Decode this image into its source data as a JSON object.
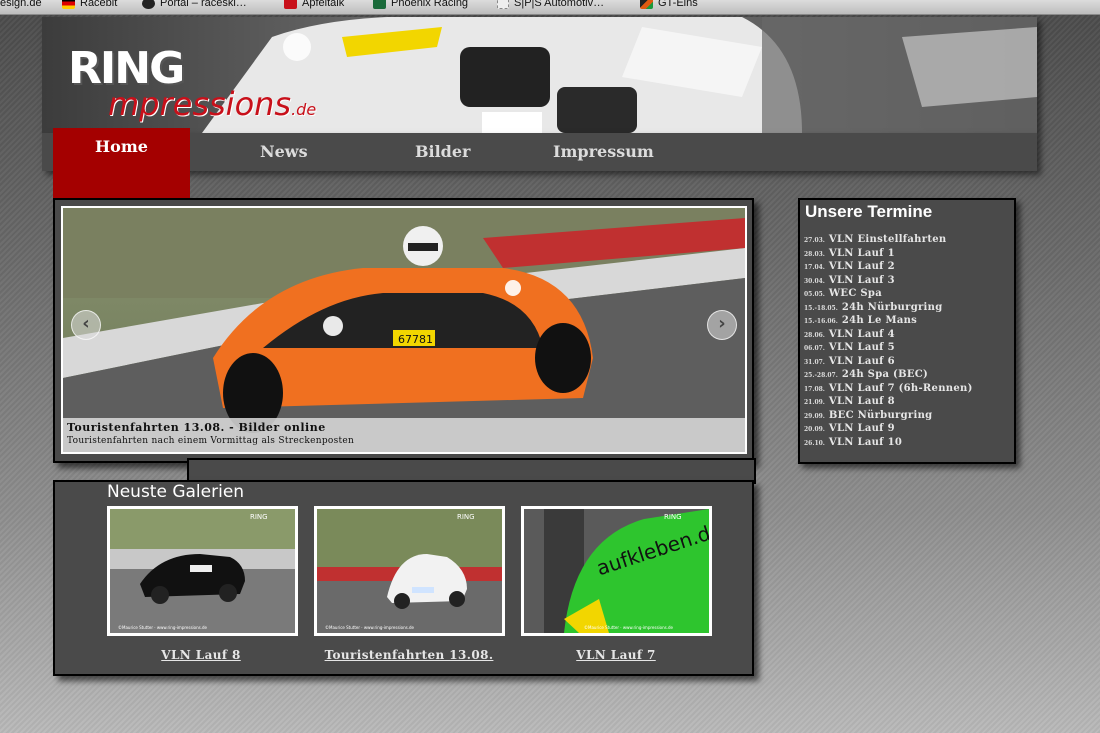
{
  "bookmarks": [
    {
      "label": "esign.de",
      "icon": "none",
      "color": "#000000"
    },
    {
      "label": "Racebit",
      "icon": "german-flag-icon",
      "color": "#cc0000"
    },
    {
      "label": "Portal – raceski…",
      "icon": "gear-icon",
      "color": "#222222"
    },
    {
      "label": "Apfeltalk",
      "icon": "apple-icon",
      "color": "#c8101a"
    },
    {
      "label": "Phoenix Racing",
      "icon": "p-icon",
      "color": "#1a6a3a"
    },
    {
      "label": "S|P|S Automotiv…",
      "icon": "page-icon",
      "color": "#9a9a9a"
    },
    {
      "label": "GT-Eins",
      "icon": "flame-icon",
      "color": "#d24a10"
    }
  ],
  "header": {
    "logo_main": "RING",
    "logo_sub": "mpressions",
    "logo_tld": ".de"
  },
  "nav": {
    "home": "Home",
    "news": "News",
    "bilder": "Bilder",
    "impressum": "Impressum"
  },
  "slider": {
    "caption_title": "Touristenfahrten 13.08. - Bilder online",
    "caption_desc": "Touristenfahrten nach einem Vormittag als Streckenposten",
    "prev_symbol": "‹",
    "next_symbol": "›",
    "plate": "67781"
  },
  "termine": {
    "title": "Unsere Termine",
    "items": [
      {
        "date": "27.03.",
        "event": "VLN Einstellfahrten"
      },
      {
        "date": "28.03.",
        "event": "VLN Lauf 1"
      },
      {
        "date": "17.04.",
        "event": "VLN Lauf 2"
      },
      {
        "date": "30.04.",
        "event": "VLN Lauf 3"
      },
      {
        "date": "05.05.",
        "event": "WEC Spa"
      },
      {
        "date": "15.-18.05.",
        "event": "24h Nürburgring"
      },
      {
        "date": "15.-16.06.",
        "event": "24h Le Mans"
      },
      {
        "date": "28.06.",
        "event": "VLN Lauf 4"
      },
      {
        "date": "06.07.",
        "event": "VLN Lauf 5"
      },
      {
        "date": "31.07.",
        "event": "VLN Lauf 6"
      },
      {
        "date": "25.-28.07.",
        "event": "24h Spa (BEC)"
      },
      {
        "date": "17.08.",
        "event": "VLN Lauf 7 (6h-Rennen)"
      },
      {
        "date": "21.09.",
        "event": "VLN Lauf 8"
      },
      {
        "date": "29.09.",
        "event": "BEC Nürburgring"
      },
      {
        "date": "20.09.",
        "event": "VLN Lauf 9"
      },
      {
        "date": "26.10.",
        "event": "VLN Lauf 10"
      }
    ]
  },
  "galleries": {
    "title": "Neuste Galerien",
    "items": [
      {
        "label": "VLN Lauf 8"
      },
      {
        "label": "Touristenfahrten 13.08."
      },
      {
        "label": "VLN Lauf 7"
      }
    ],
    "watermark": "©Maurice Stutter · www.ring-impressions.de",
    "sticker": "aufkleben.de"
  },
  "colors": {
    "accent_red": "#a40000",
    "panel_gray": "#4a4a4a"
  }
}
